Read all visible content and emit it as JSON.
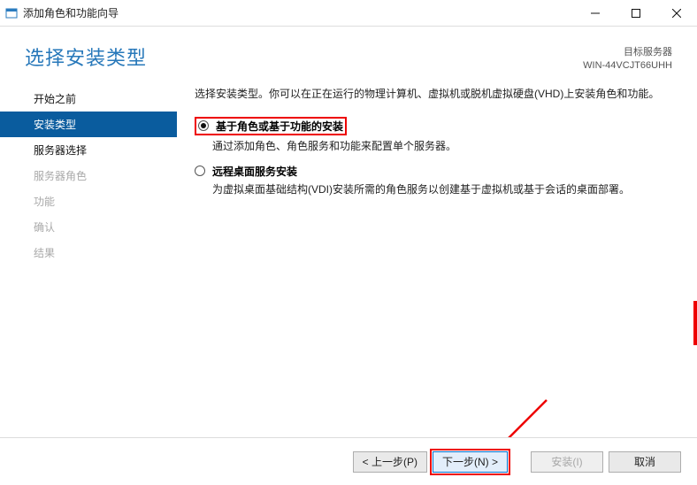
{
  "window": {
    "title": "添加角色和功能向导"
  },
  "header": {
    "title": "选择安装类型",
    "target_label": "目标服务器",
    "target_value": "WIN-44VCJT66UHH"
  },
  "sidebar": {
    "items": [
      {
        "label": "开始之前",
        "enabled": true,
        "active": false
      },
      {
        "label": "安装类型",
        "enabled": true,
        "active": true
      },
      {
        "label": "服务器选择",
        "enabled": true,
        "active": false
      },
      {
        "label": "服务器角色",
        "enabled": false,
        "active": false
      },
      {
        "label": "功能",
        "enabled": false,
        "active": false
      },
      {
        "label": "确认",
        "enabled": false,
        "active": false
      },
      {
        "label": "结果",
        "enabled": false,
        "active": false
      }
    ]
  },
  "content": {
    "intro": "选择安装类型。你可以在正在运行的物理计算机、虚拟机或脱机虚拟硬盘(VHD)上安装角色和功能。",
    "options": [
      {
        "title": "基于角色或基于功能的安装",
        "desc": "通过添加角色、角色服务和功能来配置单个服务器。",
        "checked": true,
        "highlighted": true
      },
      {
        "title": "远程桌面服务安装",
        "desc": "为虚拟桌面基础结构(VDI)安装所需的角色服务以创建基于虚拟机或基于会话的桌面部署。",
        "checked": false,
        "highlighted": false
      }
    ]
  },
  "footer": {
    "prev": "< 上一步(P)",
    "next": "下一步(N) >",
    "install": "安装(I)",
    "cancel": "取消"
  }
}
